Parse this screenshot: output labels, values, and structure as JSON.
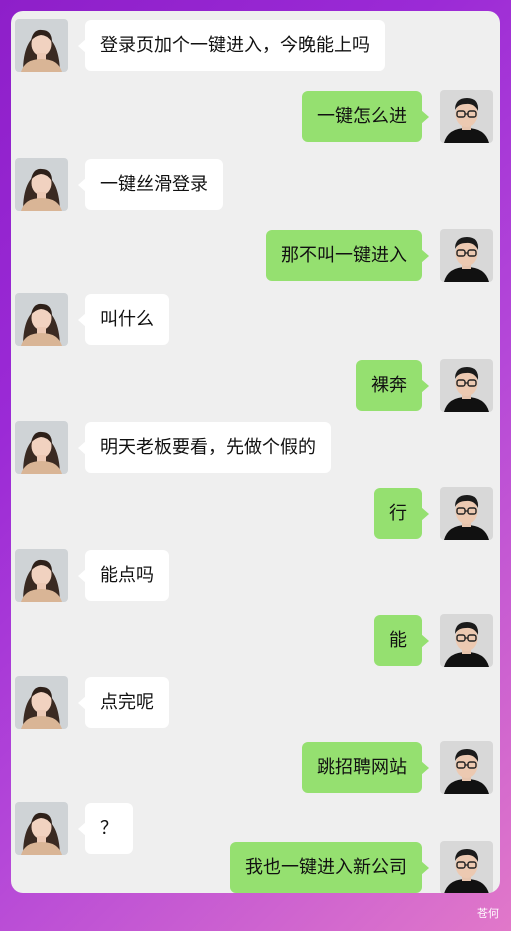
{
  "colors": {
    "background_gradient": [
      "#8e1fc9",
      "#e178c9"
    ],
    "chat_background": "#efefef",
    "incoming_bubble": "#ffffff",
    "outgoing_bubble": "#95e070"
  },
  "avatars": {
    "incoming": "woman-avatar",
    "outgoing": "man-with-glasses-avatar"
  },
  "messages": [
    {
      "sender": "other",
      "text": "登录页加个一键进入，今晚能上吗"
    },
    {
      "sender": "me",
      "text": "一键怎么进"
    },
    {
      "sender": "other",
      "text": "一键丝滑登录"
    },
    {
      "sender": "me",
      "text": "那不叫一键进入"
    },
    {
      "sender": "other",
      "text": "叫什么"
    },
    {
      "sender": "me",
      "text": "裸奔"
    },
    {
      "sender": "other",
      "text": "明天老板要看，先做个假的"
    },
    {
      "sender": "me",
      "text": "行"
    },
    {
      "sender": "other",
      "text": "能点吗"
    },
    {
      "sender": "me",
      "text": "能"
    },
    {
      "sender": "other",
      "text": "点完呢"
    },
    {
      "sender": "me",
      "text": "跳招聘网站"
    },
    {
      "sender": "other",
      "text": "？"
    },
    {
      "sender": "me",
      "text": "我也一键进入新公司"
    }
  ],
  "watermark": "苍何"
}
